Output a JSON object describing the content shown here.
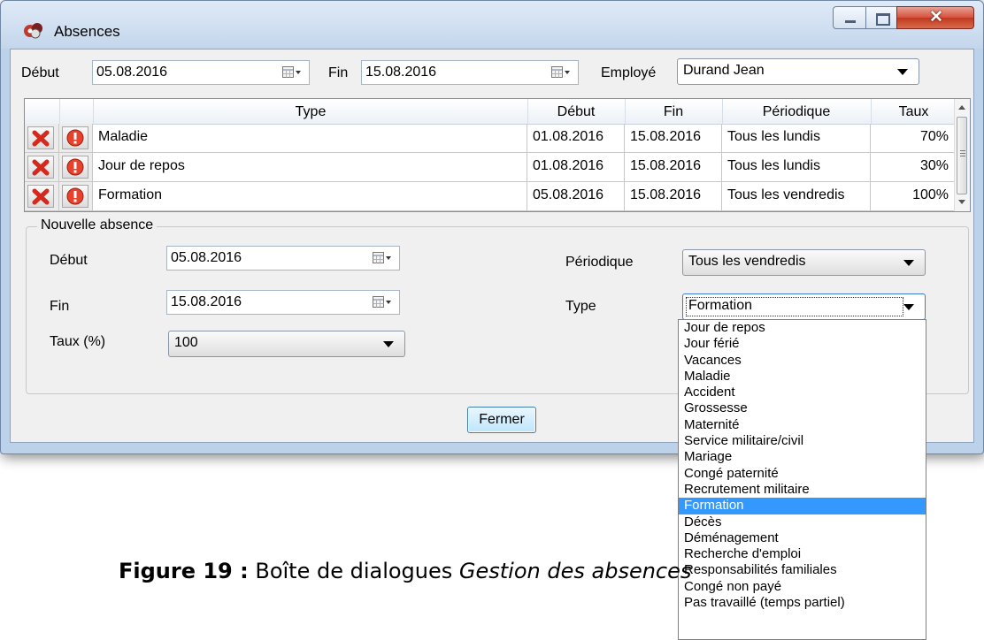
{
  "window": {
    "title": "Absences"
  },
  "filter": {
    "debut_label": "Début",
    "debut_value": "05.08.2016",
    "fin_label": "Fin",
    "fin_value": "15.08.2016",
    "employe_label": "Employé",
    "employe_value": "Durand Jean"
  },
  "grid": {
    "columns": [
      "Type",
      "Début",
      "Fin",
      "Périodique",
      "Taux"
    ],
    "rows": [
      {
        "type": "Maladie",
        "debut": "01.08.2016",
        "fin": "15.08.2016",
        "periodique": "Tous les lundis",
        "taux": "70%"
      },
      {
        "type": "Jour de repos",
        "debut": "01.08.2016",
        "fin": "15.08.2016",
        "periodique": "Tous les lundis",
        "taux": "30%"
      },
      {
        "type": "Formation",
        "debut": "05.08.2016",
        "fin": "15.08.2016",
        "periodique": "Tous les vendredis",
        "taux": "100%"
      }
    ]
  },
  "nouvelle": {
    "group_label": "Nouvelle absence",
    "debut_label": "Début",
    "debut_value": "05.08.2016",
    "fin_label": "Fin",
    "fin_value": "15.08.2016",
    "taux_label": "Taux (%)",
    "taux_value": "100",
    "periodique_label": "Périodique",
    "periodique_value": "Tous les vendredis",
    "type_label": "Type",
    "type_value": "Formation"
  },
  "fermer_label": "Fermer",
  "type_options": [
    "Jour de repos",
    "Jour férié",
    "Vacances",
    "Maladie",
    "Accident",
    "Grossesse",
    "Maternité",
    "Service militaire/civil",
    "Mariage",
    "Congé paternité",
    "Recrutement militaire",
    "Formation",
    "Décès",
    "Déménagement",
    "Recherche d'emploi",
    "Responsabilités familiales",
    "Congé non payé",
    "Pas travaillé (temps partiel)"
  ],
  "type_selected": "Formation",
  "caption": {
    "prefix": "Figure 19 :",
    "text": " Boîte de dialogues ",
    "italic": "Gestion des absences"
  },
  "colors": {
    "selection": "#3399ff",
    "close_button": "#c9452b",
    "titlebar": "#c4d6ec"
  }
}
